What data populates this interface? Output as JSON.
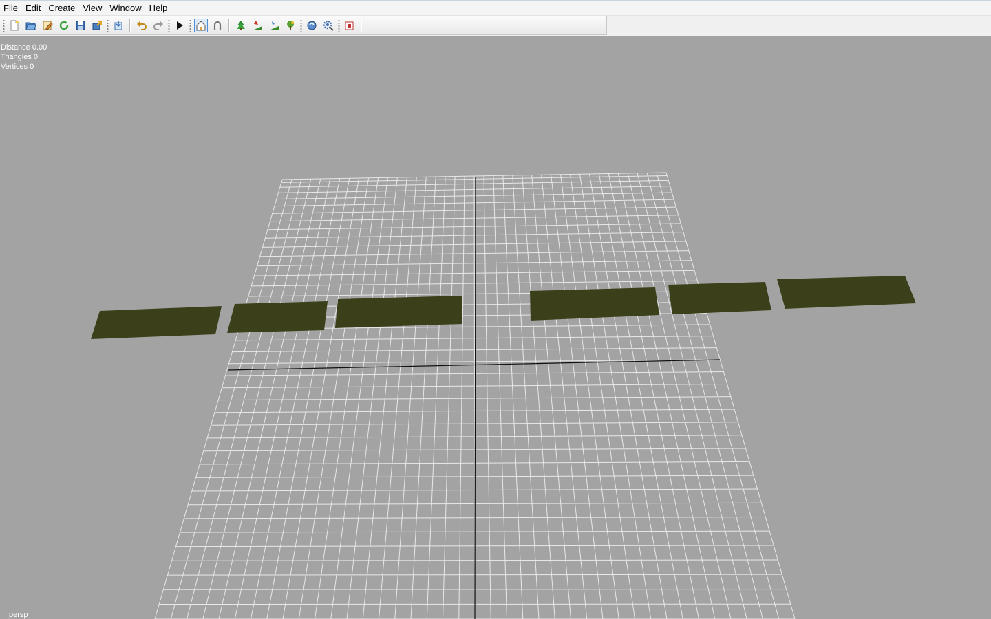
{
  "menu": {
    "items": [
      {
        "key": "F",
        "rest": "ile"
      },
      {
        "key": "E",
        "rest": "dit"
      },
      {
        "key": "C",
        "rest": "reate"
      },
      {
        "key": "V",
        "rest": "iew"
      },
      {
        "key": "W",
        "rest": "indow"
      },
      {
        "key": "H",
        "rest": "elp"
      }
    ]
  },
  "toolbar": {
    "icons": [
      "new-file-icon",
      "open-folder-icon",
      "edit-icon",
      "refresh-icon",
      "save-icon",
      "export-icon",
      "import-icon",
      "undo-icon",
      "redo-icon",
      "play-icon",
      "home-view-icon",
      "magnet-icon",
      "tree-icon",
      "slope-tool-icon",
      "raise-tool-icon",
      "plant-tool-icon",
      "rotate-icon",
      "settings-icon",
      "stop-icon"
    ],
    "active_icon": "home-view-icon"
  },
  "stats": {
    "distance": "Distance 0.00",
    "triangles": "Triangles 0",
    "vertices": "Vertices 0"
  },
  "viewport": {
    "camera_label": "persp",
    "background_color": "#a3a3a3",
    "grid_color": "#e8e8e8",
    "axis_color": "#111111",
    "terrain_color": "#3c401a"
  }
}
